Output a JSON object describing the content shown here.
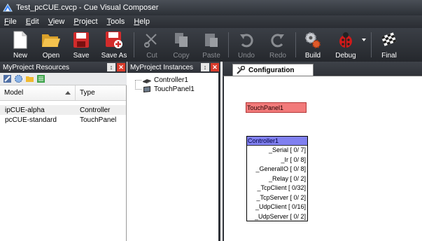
{
  "window": {
    "title": "Test_pcCUE.cvcp - Cue Visual Composer"
  },
  "menu": [
    "File",
    "Edit",
    "View",
    "Project",
    "Tools",
    "Help"
  ],
  "toolbar": {
    "new": {
      "label": "New",
      "icon": "new-document-icon"
    },
    "open": {
      "label": "Open",
      "icon": "open-folder-icon"
    },
    "save": {
      "label": "Save",
      "icon": "floppy-disk-icon"
    },
    "save_as": {
      "label": "Save As",
      "icon": "save-as-icon"
    },
    "cut": {
      "label": "Cut",
      "icon": "scissors-icon",
      "disabled": true
    },
    "copy": {
      "label": "Copy",
      "icon": "copy-icon",
      "disabled": true
    },
    "paste": {
      "label": "Paste",
      "icon": "paste-icon",
      "disabled": true
    },
    "undo": {
      "label": "Undo",
      "icon": "undo-icon",
      "disabled": true
    },
    "redo": {
      "label": "Redo",
      "icon": "redo-icon",
      "disabled": true
    },
    "build": {
      "label": "Build",
      "icon": "gears-icon"
    },
    "debug": {
      "label": "Debug",
      "icon": "ladybug-icon"
    },
    "final": {
      "label": "Final",
      "icon": "checkered-flag-icon"
    }
  },
  "resources_panel": {
    "title": "MyProject Resources",
    "columns": {
      "model": "Model",
      "type": "Type"
    },
    "rows": [
      {
        "model": "ipCUE-alpha",
        "type": "Controller"
      },
      {
        "model": "pcCUE-standard",
        "type": "TouchPanel"
      }
    ]
  },
  "instances_panel": {
    "title": "MyProject Instances",
    "items": [
      "Controller1",
      "TouchPanel1"
    ]
  },
  "design": {
    "tab_label": "Configuration",
    "touchpanel_node": {
      "label": "TouchPanel1",
      "color": "#f27a7a"
    },
    "controller_node": {
      "label": "Controller1",
      "color": "#8080f0",
      "ports": [
        "_Serial [ 0/ 7]",
        "_Ir [ 0/ 8]",
        "_GeneralIO [ 0/ 8]",
        "_Relay [ 0/ 2]",
        "_TcpClient [ 0/32]",
        "_TcpServer [ 0/ 2]",
        "_UdpClient [ 0/16]",
        "_UdpServer [ 0/ 2]"
      ]
    }
  },
  "colors": {
    "chrome_dark": "#2f3238",
    "touchpanel_fill": "#f27a7a",
    "controller_header": "#8080f0"
  }
}
